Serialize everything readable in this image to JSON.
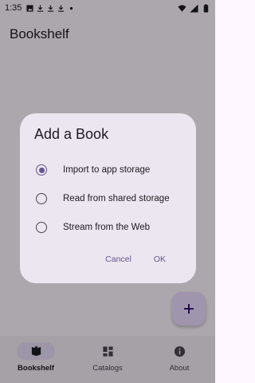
{
  "status_bar": {
    "time": "1:35",
    "notification_icons": [
      "image-icon",
      "download-icon",
      "download-icon",
      "download-icon",
      "dot-icon"
    ],
    "system_icons": [
      "wifi-icon",
      "signal-icon",
      "battery-icon"
    ]
  },
  "app_bar": {
    "title": "Bookshelf"
  },
  "fab": {
    "icon": "plus-icon"
  },
  "bottom_nav": {
    "items": [
      {
        "label": "Bookshelf",
        "icon": "book-icon",
        "active": true
      },
      {
        "label": "Catalogs",
        "icon": "grid-icon",
        "active": false
      },
      {
        "label": "About",
        "icon": "info-icon",
        "active": false
      }
    ]
  },
  "dialog": {
    "title": "Add a Book",
    "options": [
      {
        "label": "Import to app storage",
        "selected": true
      },
      {
        "label": "Read from shared storage",
        "selected": false
      },
      {
        "label": "Stream from the Web",
        "selected": false
      }
    ],
    "cancel_label": "Cancel",
    "ok_label": "OK"
  },
  "colors": {
    "accent": "#65558f",
    "surface": "#fef7ff",
    "dialog": "#ece6f0",
    "nav": "#f3edf7",
    "fab": "#eaddff"
  }
}
